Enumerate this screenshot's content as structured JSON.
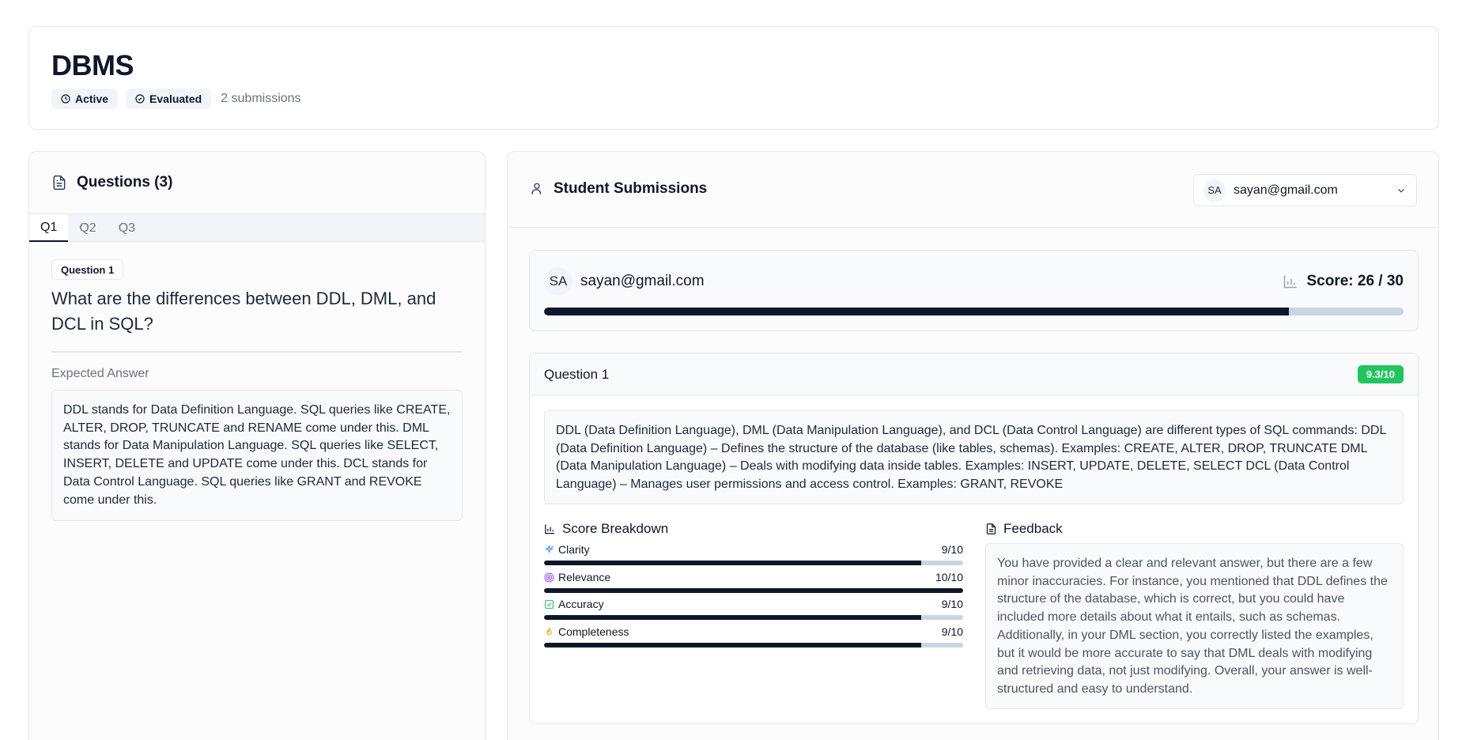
{
  "header": {
    "title": "DBMS",
    "status_active": "Active",
    "status_evaluated": "Evaluated",
    "submissions": "2 submissions"
  },
  "questions": {
    "title": "Questions (3)",
    "tabs": [
      "Q1",
      "Q2",
      "Q3"
    ],
    "active_tab": "Q1",
    "badge": "Question 1",
    "text": "What are the differences between DDL, DML, and DCL in SQL?",
    "expected_label": "Expected Answer",
    "expected_answer": "DDL stands for Data Definition Language. SQL queries like CREATE, ALTER, DROP, TRUNCATE and RENAME come under this. DML stands for Data Manipulation Language. SQL queries like SELECT, INSERT, DELETE and UPDATE come under this. DCL stands for Data Control Language. SQL queries like GRANT and REVOKE come under this."
  },
  "submissions": {
    "title": "Student Submissions",
    "selected": {
      "initials": "SA",
      "email": "sayan@gmail.com"
    },
    "score_label": "Score: 26 / 30",
    "score_fraction": 0.867,
    "question_label": "Question 1",
    "question_score": "9.3/10",
    "answer": "DDL (Data Definition Language), DML (Data Manipulation Language), and DCL (Data Control Language) are different types of SQL commands: DDL (Data Definition Language) – Defines the structure of the database (like tables, schemas). Examples: CREATE, ALTER, DROP, TRUNCATE DML (Data Manipulation Language) – Deals with modifying data inside tables. Examples: INSERT, UPDATE, DELETE, SELECT DCL (Data Control Language) – Manages user permissions and access control. Examples: GRANT, REVOKE",
    "breakdown_title": "Score Breakdown",
    "metrics": [
      {
        "label": "Clarity",
        "value": "9/10",
        "fraction": 0.9,
        "icon": "sparkles-icon",
        "color": "#3b82f6"
      },
      {
        "label": "Relevance",
        "value": "10/10",
        "fraction": 1.0,
        "icon": "target-icon",
        "color": "#a855f7"
      },
      {
        "label": "Accuracy",
        "value": "9/10",
        "fraction": 0.9,
        "icon": "check-square-icon",
        "color": "#22c55e"
      },
      {
        "label": "Completeness",
        "value": "9/10",
        "fraction": 0.9,
        "icon": "flame-icon",
        "color": "#f59e0b"
      }
    ],
    "feedback_title": "Feedback",
    "feedback": "You have provided a clear and relevant answer, but there are a few minor inaccuracies. For instance, you mentioned that DDL defines the structure of the database, which is correct, but you could have included more details about what it entails, such as schemas. Additionally, in your DML section, you correctly listed the examples, but it would be more accurate to say that DML deals with modifying and retrieving data, not just modifying. Overall, your answer is well-structured and easy to understand."
  },
  "colors": {
    "primary": "#0f172a",
    "track": "#cbd5e1",
    "success": "#22c55e"
  }
}
